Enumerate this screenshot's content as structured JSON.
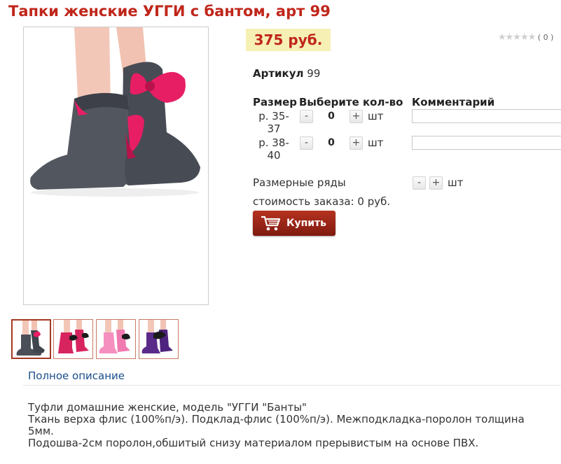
{
  "product": {
    "title": "Тапки женские УГГИ с бантом, арт 99",
    "price": "375 руб.",
    "rating_count": "( 0 )",
    "article_label": "Артикул",
    "article_value": "99"
  },
  "table": {
    "headers": {
      "size": "Размер",
      "qty": "Выберите кол-во",
      "comment": "Комментарий"
    },
    "rows": [
      {
        "size": "р. 35-37",
        "minus": "-",
        "qty": "0",
        "plus": "+",
        "unit": "шт",
        "comment": ""
      },
      {
        "size": "р. 38-40",
        "minus": "-",
        "qty": "0",
        "plus": "+",
        "unit": "шт",
        "comment": ""
      }
    ],
    "size_rows": {
      "label": "Размерные ряды",
      "minus": "-",
      "plus": "+",
      "unit": "шт"
    },
    "order_total": "стоимость заказа: 0 руб."
  },
  "buy_button": "Купить",
  "gallery": {
    "thumb_colors": [
      "#4b4f58",
      "#d7245f",
      "#f58fbf",
      "#5a2a8a"
    ],
    "active_index": 0
  },
  "description": {
    "link": "Полное описание",
    "lines": [
      "Туфли домашние женские, модель \"УГГИ \"Банты\"",
      "Ткань верха флис (100%п/э). Подклад-флис (100%п/э). Межподкладка-поролон толщина",
      "5мм.",
      "Подошва-2см поролон,обшитый снизу материалом прерывистым на основе ПВХ."
    ]
  },
  "colors": {
    "accent_red": "#c0261a",
    "price_bg": "#f6f0b4",
    "link_blue": "#1a4e8a",
    "boot_grey": "#4b4f58",
    "bow_pink": "#e81e64"
  }
}
